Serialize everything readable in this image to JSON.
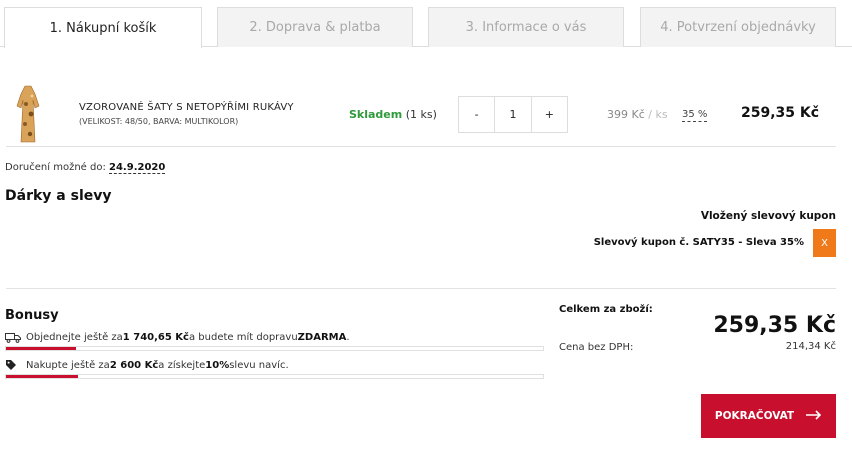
{
  "steps": [
    {
      "label": "1. Nákupní košík"
    },
    {
      "label": "2. Doprava & platba"
    },
    {
      "label": "3. Informace o vás"
    },
    {
      "label": "4. Potvrzení objednávky"
    }
  ],
  "product": {
    "name": "VZOROVANÉ ŠATY S NETOPÝŘÍMI RUKÁVY",
    "variant": "(VELIKOST: 48/50, BARVA: MULTIKOLOR)",
    "stock_status": "Skladem",
    "stock_qty": "(1 ks)",
    "qty_minus": "-",
    "quantity": "1",
    "qty_plus": "+",
    "unit_price": "399 Kč",
    "unit_per": "/ ks",
    "discount": "35 %",
    "line_total": "259,35 Kč"
  },
  "delivery": {
    "label": "Doručení možné do:",
    "date": "24.9.2020"
  },
  "gifts": {
    "title": "Dárky a slevy",
    "coupon_title": "Vložený slevový kupon",
    "coupon_text": "Slevový kupon č. SATY35 - Sleva 35%",
    "remove_label": "X"
  },
  "bonuses": {
    "title": "Bonusy",
    "shipping": {
      "p1": "Objednejte ještě za ",
      "amount": "1 740,65 Kč",
      "p2": " a budete mít dopravu ",
      "bold": "ZDARMA",
      "p3": ".",
      "progress": 0.13
    },
    "discount": {
      "p1": "Nakupte ještě za ",
      "amount": "2 600 Kč",
      "p2": " a získejte ",
      "bold": "10%",
      "p3": " slevu navíc.",
      "progress": 0.135
    }
  },
  "summary": {
    "label": "Celkem za zboží:",
    "total": "259,35 Kč",
    "novat_label": "Cena bez DPH:",
    "novat_value": "214,34 Kč"
  },
  "continue_label": "POKRAČOVAT",
  "colors": {
    "accent": "#c8102e",
    "stock_green": "#2e9a3a",
    "coupon_orange": "#f07a1a"
  }
}
